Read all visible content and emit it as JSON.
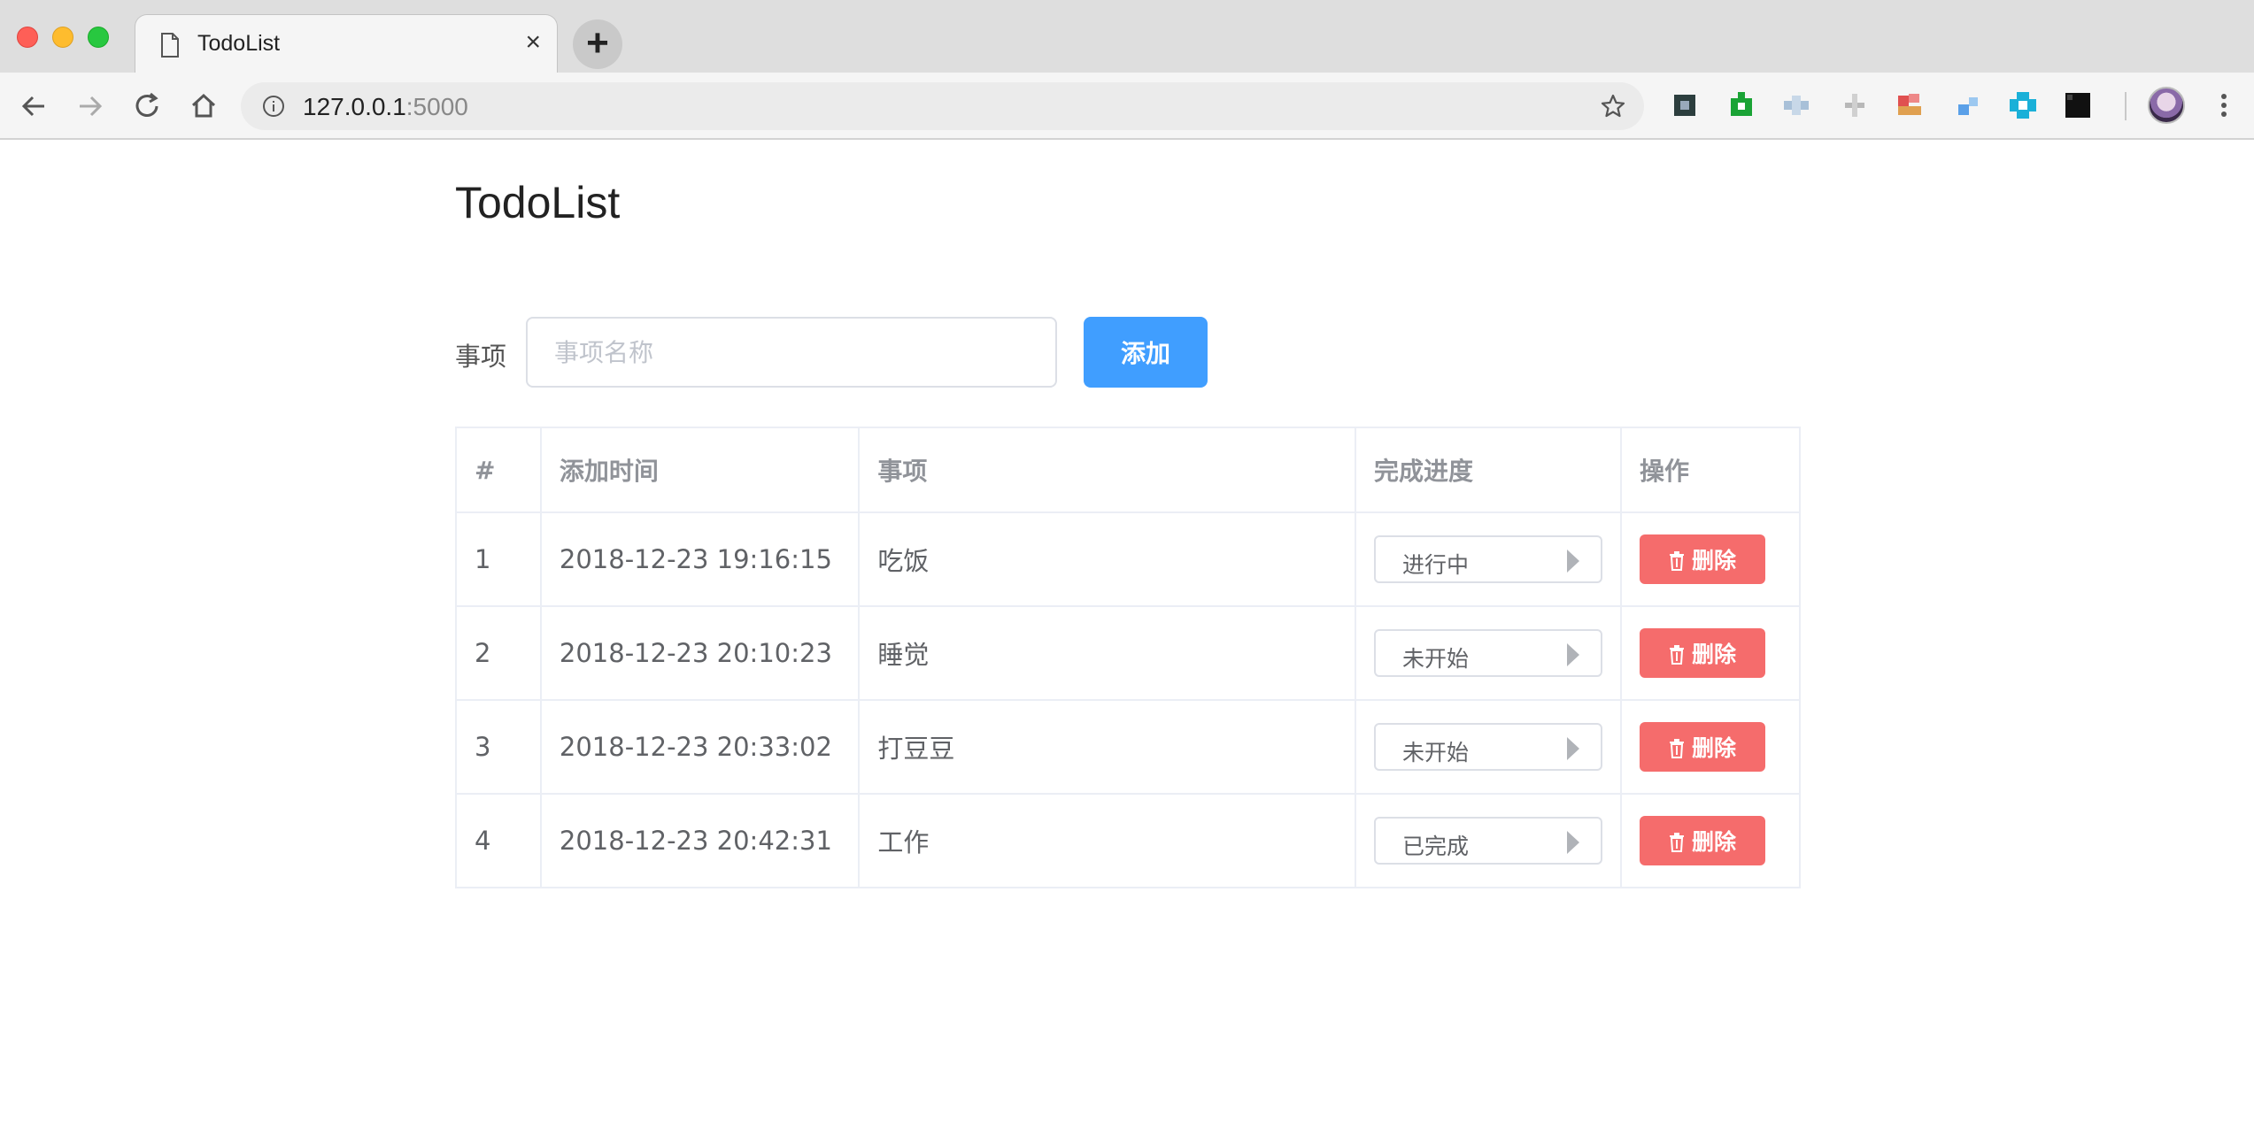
{
  "browser": {
    "tab_title": "TodoList",
    "tab_close": "×",
    "new_tab": "+",
    "url_host": "127.0.0.1",
    "url_port": ":5000",
    "extension_colors": [
      "#2c3e3e",
      "#1aa335",
      "#a8c0d8",
      "#b8b8b8",
      "#e05050",
      "#5aa0e8",
      "#1ab0d8",
      "#111111"
    ]
  },
  "page": {
    "title": "TodoList"
  },
  "form": {
    "label": "事项",
    "placeholder": "事项名称",
    "input_value": "",
    "add_label": "添加"
  },
  "table": {
    "headers": [
      "#",
      "添加时间",
      "事项",
      "完成进度",
      "操作"
    ],
    "delete_label": "删除",
    "rows": [
      {
        "id": "1",
        "time": "2018-12-23 19:16:15",
        "item": "吃饭",
        "status": "进行中"
      },
      {
        "id": "2",
        "time": "2018-12-23 20:10:23",
        "item": "睡觉",
        "status": "未开始"
      },
      {
        "id": "3",
        "time": "2018-12-23 20:33:02",
        "item": "打豆豆",
        "status": "未开始"
      },
      {
        "id": "4",
        "time": "2018-12-23 20:42:31",
        "item": "工作",
        "status": "已完成"
      }
    ]
  },
  "colors": {
    "primary": "#409eff",
    "danger": "#f56c6c"
  }
}
